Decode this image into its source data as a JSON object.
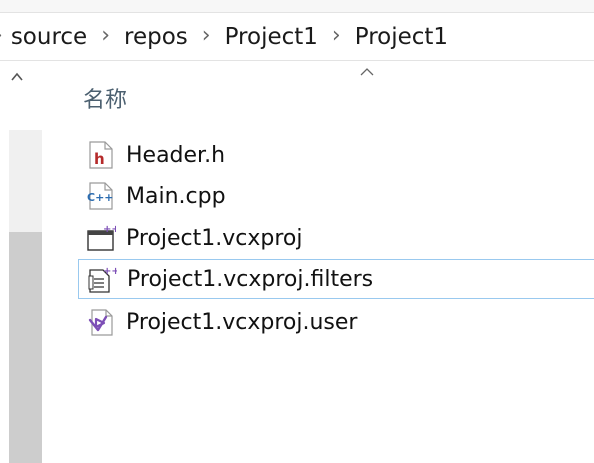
{
  "breadcrumb": {
    "items": [
      "source",
      "repos",
      "Project1",
      "Project1"
    ]
  },
  "columns": {
    "name_header": "名称"
  },
  "files": [
    {
      "name": "Header.h",
      "icon": "header-file-icon"
    },
    {
      "name": "Main.cpp",
      "icon": "cpp-file-icon"
    },
    {
      "name": "Project1.vcxproj",
      "icon": "vcxproj-file-icon"
    },
    {
      "name": "Project1.vcxproj.filters",
      "icon": "filters-file-icon",
      "selected": true
    },
    {
      "name": "Project1.vcxproj.user",
      "icon": "vs-user-file-icon"
    }
  ],
  "colors": {
    "header_text": "#4c6070",
    "selection_border": "#99c9ef",
    "scroll_thumb": "#cdcdcd",
    "header_icon_red": "#b52a2a",
    "cpp_blue": "#2b6cb0",
    "vs_purple": "#7d4fb6"
  }
}
